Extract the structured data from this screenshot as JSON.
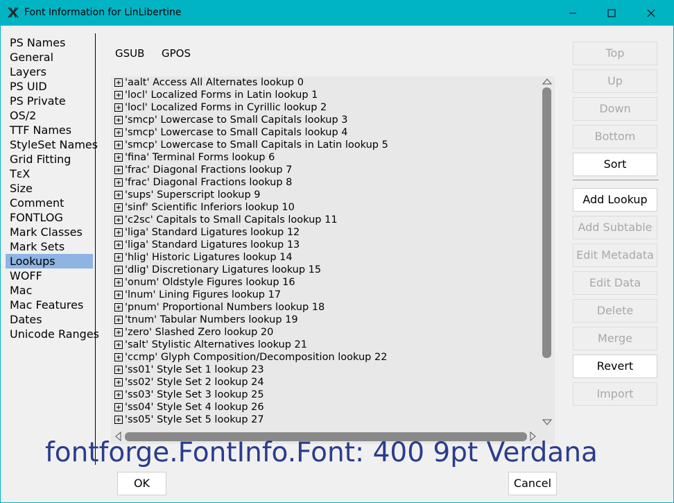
{
  "window": {
    "title": "Font Information for LinLibertine"
  },
  "sidebar": {
    "items": [
      {
        "label": "PS Names",
        "selected": false
      },
      {
        "label": "General",
        "selected": false
      },
      {
        "label": "Layers",
        "selected": false
      },
      {
        "label": "PS UID",
        "selected": false
      },
      {
        "label": "PS Private",
        "selected": false
      },
      {
        "label": "OS/2",
        "selected": false
      },
      {
        "label": "TTF Names",
        "selected": false
      },
      {
        "label": "StyleSet Names",
        "selected": false
      },
      {
        "label": "Grid Fitting",
        "selected": false
      },
      {
        "label": "TεX",
        "selected": false
      },
      {
        "label": "Size",
        "selected": false
      },
      {
        "label": "Comment",
        "selected": false
      },
      {
        "label": "FONTLOG",
        "selected": false
      },
      {
        "label": "Mark Classes",
        "selected": false
      },
      {
        "label": "Mark Sets",
        "selected": false
      },
      {
        "label": "Lookups",
        "selected": true
      },
      {
        "label": "WOFF",
        "selected": false
      },
      {
        "label": "Mac",
        "selected": false
      },
      {
        "label": "Mac Features",
        "selected": false
      },
      {
        "label": "Dates",
        "selected": false
      },
      {
        "label": "Unicode Ranges",
        "selected": false
      }
    ]
  },
  "tabs": {
    "gsub": "GSUB",
    "gpos": "GPOS"
  },
  "lookups": [
    "'aalt' Access All Alternates lookup 0",
    "'locl' Localized Forms in Latin lookup 1",
    "'locl' Localized Forms in Cyrillic lookup 2",
    "'smcp' Lowercase to Small Capitals lookup 3",
    "'smcp' Lowercase to Small Capitals lookup 4",
    "'smcp' Lowercase to Small Capitals in Latin lookup 5",
    "'fina' Terminal Forms lookup 6",
    "'frac' Diagonal Fractions lookup 7",
    "'frac' Diagonal Fractions lookup 8",
    "'sups' Superscript lookup 9",
    "'sinf' Scientific Inferiors lookup 10",
    "'c2sc' Capitals to Small Capitals lookup 11",
    "'liga' Standard Ligatures lookup 12",
    "'liga' Standard Ligatures lookup 13",
    "'hlig' Historic Ligatures lookup 14",
    "'dlig' Discretionary Ligatures lookup 15",
    "'onum' Oldstyle Figures lookup 16",
    "'lnum' Lining Figures lookup 17",
    "'pnum' Proportional Numbers lookup 18",
    "'tnum' Tabular Numbers lookup 19",
    "'zero' Slashed Zero lookup 20",
    "'salt' Stylistic Alternatives lookup 21",
    "'ccmp' Glyph Composition/Decomposition lookup 22",
    "'ss01' Style Set 1 lookup 23",
    "'ss02' Style Set 2 lookup 24",
    "'ss03' Style Set 3 lookup 25",
    "'ss04' Style Set 4 lookup 26",
    "'ss05' Style Set 5 lookup 27"
  ],
  "buttons": {
    "top": "Top",
    "up": "Up",
    "down": "Down",
    "bottom": "Bottom",
    "sort": "Sort",
    "add_lookup": "Add Lookup",
    "add_subtable": "Add Subtable",
    "edit_metadata": "Edit Metadata",
    "edit_data": "Edit Data",
    "delete": "Delete",
    "merge": "Merge",
    "revert": "Revert",
    "import": "Import",
    "ok": "OK",
    "cancel": "Cancel"
  },
  "overlay_text": "fontforge.FontInfo.Font: 400 9pt Verdana",
  "icons": {
    "app": "fontforge-app-icon",
    "minimize": "minimize-icon",
    "maximize": "maximize-icon",
    "close": "close-icon",
    "expander": "plus-box-icon"
  }
}
